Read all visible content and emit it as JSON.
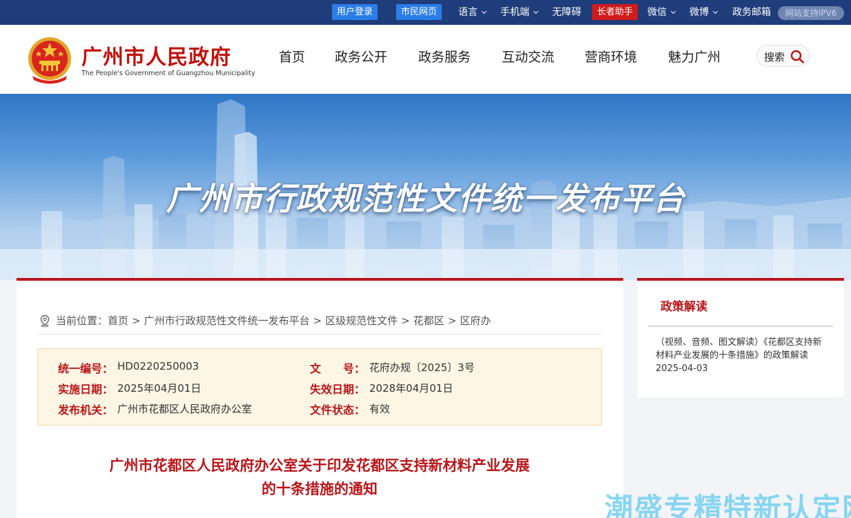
{
  "topbar": {
    "login": "用户登录",
    "citizen_page": "市民网页",
    "language": "语言",
    "mobile": "手机端",
    "accessibility": "无障碍",
    "elder_helper": "长者助手",
    "wechat": "微信",
    "weibo": "微博",
    "gov_mail": "政务邮箱",
    "ipv6": "网站支持IPV6"
  },
  "header": {
    "logo_cn": "广州市人民政府",
    "logo_en": "The People's Government of Guangzhou Municipality",
    "nav": [
      "首页",
      "政务公开",
      "政务服务",
      "互动交流",
      "营商环境",
      "魅力广州"
    ],
    "search_label": "搜索"
  },
  "banner": {
    "title": "广州市行政规范性文件统一发布平台"
  },
  "breadcrumb": {
    "prefix": "当前位置：",
    "items": [
      "首页",
      "广州市行政规范性文件统一发布平台",
      "区级规范性文件",
      "花都区",
      "区府办"
    ],
    "separator": ">"
  },
  "meta": {
    "rows": [
      {
        "label1": "统一编号：",
        "value1": "HD0220250003",
        "label2": "文　　号：",
        "value2": "花府办规〔2025〕3号"
      },
      {
        "label1": "实施日期：",
        "value1": "2025年04月01日",
        "label2": "失效日期：",
        "value2": "2028年04月01日"
      },
      {
        "label1": "发布机关：",
        "value1": "广州市花都区人民政府办公室",
        "label2": "文件状态：",
        "value2": "有效"
      }
    ]
  },
  "document": {
    "title_line1": "广州市花都区人民政府办公室关于印发花都区支持新材料产业发展",
    "title_line2": "的十条措施的通知"
  },
  "sidebar": {
    "title": "政策解读",
    "item_text": "（视频、音频、图文解读）《花都区支持新材料产业发展的十条措施》的政策解读　2025-04-03"
  },
  "watermark": "潮盛专精特新认定网",
  "colors": {
    "topbar_bg": "#1f3d7a",
    "brand_red": "#b8161a",
    "accent_blue": "#2b7de8",
    "meta_bg": "#fdf6e5"
  }
}
